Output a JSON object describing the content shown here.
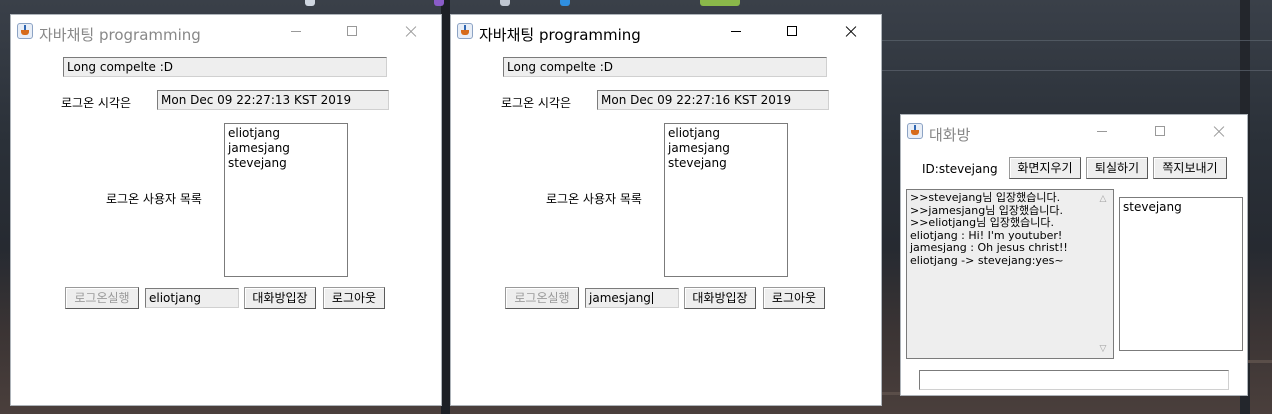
{
  "windows": [
    {
      "title": "자바채팅 programming",
      "message": "Long compelte :D",
      "login_time_label": "로그온 시각은",
      "login_time_value": "Mon Dec 09 22:27:13 KST 2019",
      "users_label": "로그온 사용자 목록",
      "users": [
        "eliotjang",
        "jamesjang",
        "stevejang"
      ],
      "login_button": "로그온실행",
      "id_value": "eliotjang",
      "enter_room_button": "대화방입장",
      "logout_button": "로그아웃"
    },
    {
      "title": "자바채팅 programming",
      "message": "Long compelte :D",
      "login_time_label": "로그온 시각은",
      "login_time_value": "Mon Dec 09 22:27:16 KST 2019",
      "users_label": "로그온 사용자 목록",
      "users": [
        "eliotjang",
        "jamesjang",
        "stevejang"
      ],
      "login_button": "로그온실행",
      "id_value": "jamesjang",
      "enter_room_button": "대화방입장",
      "logout_button": "로그아웃"
    }
  ],
  "chat_window": {
    "title": "대화방",
    "id_label": "ID:stevejang",
    "clear_button": "화면지우기",
    "leave_button": "퇴실하기",
    "whisper_button": "쪽지보내기",
    "messages": [
      ">>stevejang님 입장했습니다.",
      ">>jamesjang님 입장했습니다.",
      ">>eliotjang님 입장했습니다.",
      "eliotjang : Hi! I'm youtuber!",
      "jamesjang : Oh jesus christ!!",
      "eliotjang -> stevejang:yes~"
    ],
    "users": [
      "stevejang"
    ],
    "input_value": ""
  },
  "icons": {
    "app": "java-cup-icon",
    "minimize": "minimize-icon",
    "maximize": "maximize-icon",
    "close": "close-icon"
  }
}
